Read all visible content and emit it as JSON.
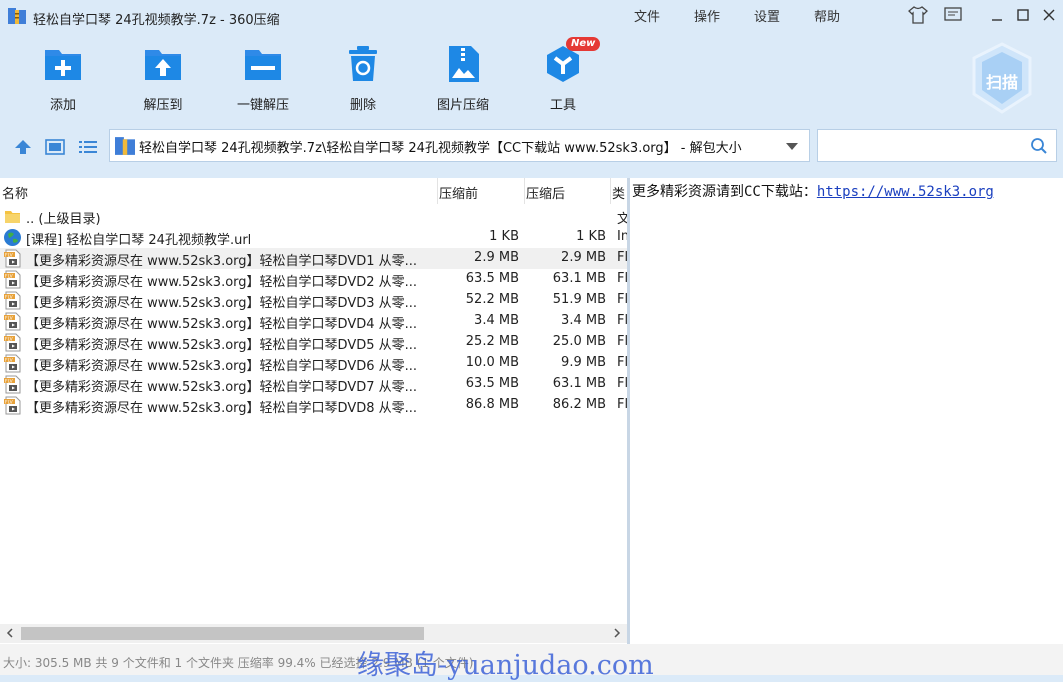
{
  "window": {
    "title": "轻松自学口琴 24孔视频教学.7z - 360压缩"
  },
  "menu": [
    "文件",
    "操作",
    "设置",
    "帮助"
  ],
  "toolbar": {
    "add": "添加",
    "extract_to": "解压到",
    "one_click_extract": "一键解压",
    "delete": "删除",
    "image_compress": "图片压缩",
    "tools": "工具",
    "new_badge": "New",
    "scan": "扫描"
  },
  "path": {
    "value": "轻松自学口琴 24孔视频教学.7z\\轻松自学口琴 24孔视频教学【CC下载站 www.52sk3.org】 - 解包大小"
  },
  "columns": {
    "name": "名称",
    "size": "压缩前",
    "packed": "压缩后",
    "type": "类"
  },
  "files": [
    {
      "name": ".. (上级目录)",
      "size": "",
      "packed": "",
      "type": "文",
      "icon": "folder-icon"
    },
    {
      "name": "[课程] 轻松自学口琴 24孔视频教学.url",
      "size": "1 KB",
      "packed": "1 KB",
      "type": "In",
      "icon": "globe-icon"
    },
    {
      "name": "【更多精彩资源尽在 www.52sk3.org】轻松自学口琴DVD1 从零...",
      "size": "2.9 MB",
      "packed": "2.9 MB",
      "type": "Fl",
      "icon": "flv-file-icon"
    },
    {
      "name": "【更多精彩资源尽在 www.52sk3.org】轻松自学口琴DVD2 从零...",
      "size": "63.5 MB",
      "packed": "63.1 MB",
      "type": "Fl",
      "icon": "flv-file-icon"
    },
    {
      "name": "【更多精彩资源尽在 www.52sk3.org】轻松自学口琴DVD3 从零...",
      "size": "52.2 MB",
      "packed": "51.9 MB",
      "type": "Fl",
      "icon": "flv-file-icon"
    },
    {
      "name": "【更多精彩资源尽在 www.52sk3.org】轻松自学口琴DVD4 从零...",
      "size": "3.4 MB",
      "packed": "3.4 MB",
      "type": "Fl",
      "icon": "flv-file-icon"
    },
    {
      "name": "【更多精彩资源尽在 www.52sk3.org】轻松自学口琴DVD5 从零...",
      "size": "25.2 MB",
      "packed": "25.0 MB",
      "type": "Fl",
      "icon": "flv-file-icon"
    },
    {
      "name": "【更多精彩资源尽在 www.52sk3.org】轻松自学口琴DVD6 从零...",
      "size": "10.0 MB",
      "packed": "9.9 MB",
      "type": "Fl",
      "icon": "flv-file-icon"
    },
    {
      "name": "【更多精彩资源尽在 www.52sk3.org】轻松自学口琴DVD7 从零...",
      "size": "63.5 MB",
      "packed": "63.1 MB",
      "type": "Fl",
      "icon": "flv-file-icon"
    },
    {
      "name": "【更多精彩资源尽在 www.52sk3.org】轻松自学口琴DVD8 从零...",
      "size": "86.8 MB",
      "packed": "86.2 MB",
      "type": "Fl",
      "icon": "flv-file-icon"
    }
  ],
  "preview": {
    "text": "更多精彩资源请到CC下载站：",
    "link": "https://www.52sk3.org"
  },
  "status": {
    "text": "大小: 305.5 MB 共 9 个文件和 1 个文件夹 压缩率 99.4% 已经选择 2.9 MB (1 个文件)"
  },
  "watermark": "缘聚岛-yuanjudao.com",
  "colors": {
    "accent": "#1e88e5",
    "background": "#dbeaf8",
    "link": "#1a3fbf",
    "watermark": "#3d63d8"
  }
}
